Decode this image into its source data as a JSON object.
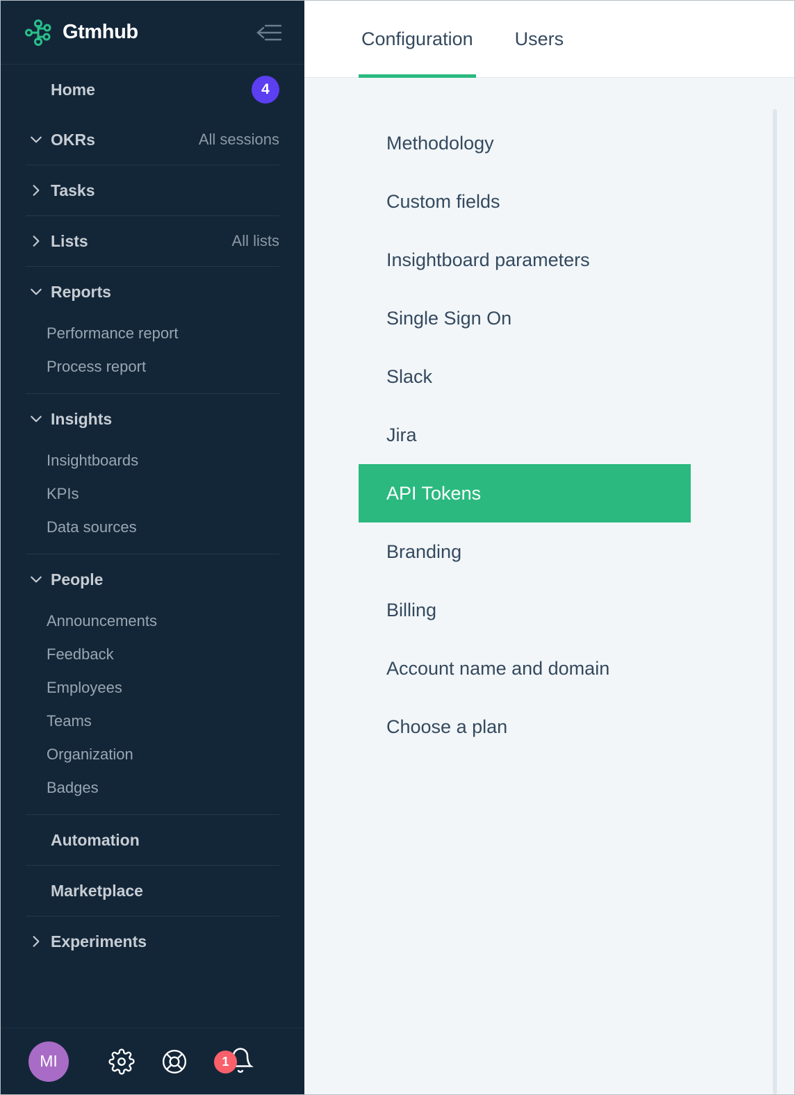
{
  "sidebar": {
    "brand": {
      "name": "Gtmhub",
      "logo_icon": "node-graph-logo-icon",
      "collapse_icon": "collapse-sidebar-icon"
    },
    "home": {
      "label": "Home",
      "badge": "4"
    },
    "sections": [
      {
        "label": "OKRs",
        "caret": "chevron-down",
        "aside": "All sessions",
        "children": []
      },
      {
        "label": "Tasks",
        "caret": "chevron-right",
        "aside": "",
        "children": []
      },
      {
        "label": "Lists",
        "caret": "chevron-right",
        "aside": "All lists",
        "children": []
      },
      {
        "label": "Reports",
        "caret": "chevron-down",
        "aside": "",
        "children": [
          "Performance report",
          "Process report"
        ]
      },
      {
        "label": "Insights",
        "caret": "chevron-down",
        "aside": "",
        "children": [
          "Insightboards",
          "KPIs",
          "Data sources"
        ]
      },
      {
        "label": "People",
        "caret": "chevron-down",
        "aside": "",
        "children": [
          "Announcements",
          "Feedback",
          "Employees",
          "Teams",
          "Organization",
          "Badges"
        ]
      },
      {
        "label": "Automation",
        "caret": "none",
        "aside": "",
        "children": []
      },
      {
        "label": "Marketplace",
        "caret": "none",
        "aside": "",
        "children": []
      },
      {
        "label": "Experiments",
        "caret": "chevron-right",
        "aside": "",
        "children": []
      }
    ],
    "footer": {
      "avatar_initials": "MI",
      "settings_icon": "gear-icon",
      "help_icon": "lifebuoy-icon",
      "notifications_icon": "bell-icon",
      "notifications_count": "1"
    }
  },
  "main": {
    "tabs": [
      {
        "label": "Configuration",
        "active": true
      },
      {
        "label": "Users",
        "active": false
      }
    ],
    "settings_items": [
      {
        "label": "Methodology",
        "selected": false
      },
      {
        "label": "Custom fields",
        "selected": false
      },
      {
        "label": "Insightboard parameters",
        "selected": false
      },
      {
        "label": "Single Sign On",
        "selected": false
      },
      {
        "label": "Slack",
        "selected": false
      },
      {
        "label": "Jira",
        "selected": false
      },
      {
        "label": "API Tokens",
        "selected": true
      },
      {
        "label": "Branding",
        "selected": false
      },
      {
        "label": "Billing",
        "selected": false
      },
      {
        "label": "Account name and domain",
        "selected": false
      },
      {
        "label": "Choose a plan",
        "selected": false
      }
    ]
  },
  "colors": {
    "sidebar_bg": "#132638",
    "accent_green": "#2bb97f",
    "badge_purple": "#5b3ff0",
    "avatar_purple": "#a96cc6",
    "notification_red": "#f9606a",
    "content_bg": "#f2f6f9"
  }
}
